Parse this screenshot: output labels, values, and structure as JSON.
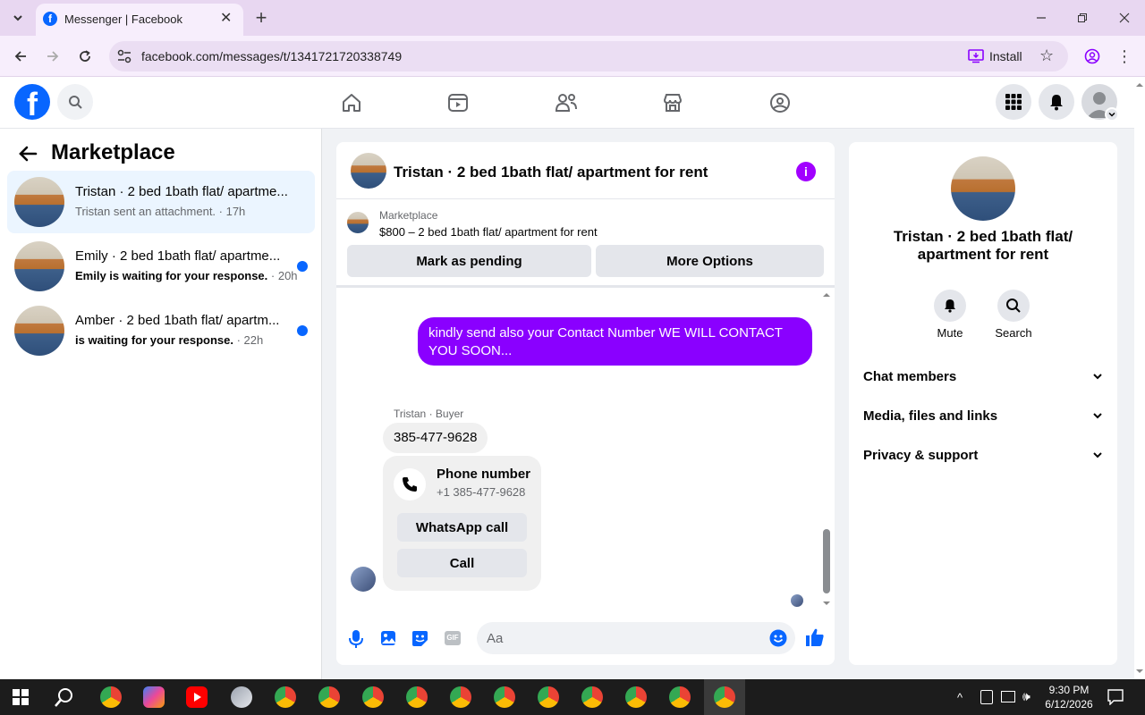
{
  "browser": {
    "tab_title": "Messenger | Facebook",
    "url": "facebook.com/messages/t/1341721720338749",
    "install_label": "Install"
  },
  "left": {
    "header": "Marketplace",
    "conversations": [
      {
        "title": "Tristan · 2 bed 1bath flat/ apartme...",
        "sub_text": "Tristan sent an attachment.",
        "time": " · 17h",
        "unread": false
      },
      {
        "title": "Emily · 2 bed 1bath flat/ apartme...",
        "sub_text": "Emily is waiting for your response.",
        "time": " · 20h",
        "unread": true
      },
      {
        "title": "Amber · 2 bed 1bath flat/ apartm...",
        "sub_text": "is waiting for your response.",
        "time": " · 22h",
        "unread": true
      }
    ]
  },
  "chat": {
    "title": "Tristan · 2 bed 1bath flat/ apartment for rent",
    "listing_label": "Marketplace",
    "listing_desc": "$800 – 2 bed 1bath flat/ apartment for rent",
    "mark_pending": "Mark as pending",
    "more_options": "More Options",
    "outgoing_message": "kindly send also your Contact Number  WE WILL CONTACT YOU SOON...",
    "sender_label": "Tristan · Buyer",
    "incoming_message": "385-477-9628",
    "phone_card_title": "Phone number",
    "phone_card_number": "+1 385-477-9628",
    "whatsapp_call": "WhatsApp call",
    "call": "Call",
    "input_placeholder": "Aa"
  },
  "right": {
    "name": "Tristan · 2 bed 1bath flat/ apartment for rent",
    "mute": "Mute",
    "search": "Search",
    "sections": [
      "Chat members",
      "Media, files and links",
      "Privacy & support"
    ]
  },
  "taskbar": {
    "time": "9:30 PM",
    "date": "6/12/2026"
  },
  "colors": {
    "fb_blue": "#0866ff",
    "messenger_purple": "#8a00ff",
    "info_purple": "#a100ff"
  }
}
